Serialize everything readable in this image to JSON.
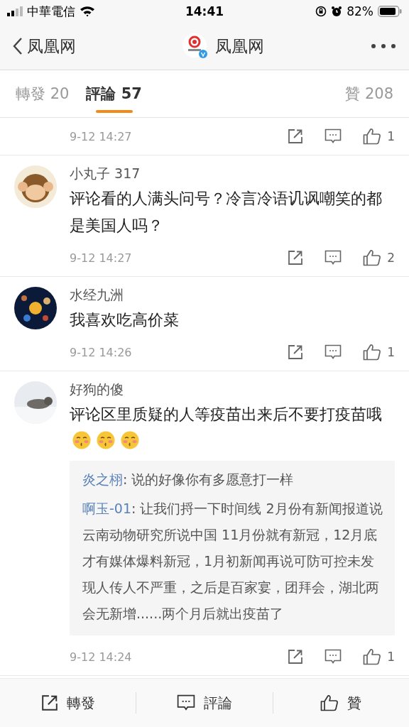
{
  "status_bar": {
    "carrier": "中華電信",
    "time": "14:41",
    "battery": "82%"
  },
  "nav": {
    "back_label": "凤凰网",
    "title": "凤凰网"
  },
  "tabs": [
    {
      "label": "轉發 20",
      "selected": false
    },
    {
      "label": "評論 57",
      "selected": true
    },
    {
      "label": "贊 208",
      "selected": false
    }
  ],
  "comments": [
    {
      "time": "9-12 14:27",
      "likes": "1"
    },
    {
      "avatar": {
        "kind": "picture"
      },
      "name": "小丸子 317",
      "text": "评论看的人满头问号？冷言冷语讥讽嘲笑的都是美国人吗？",
      "time": "9-12 14:27",
      "likes": "2"
    },
    {
      "avatar": {
        "kind": "picture"
      },
      "name": "水经九洲",
      "text": "我喜欢吃高价菜",
      "time": "9-12 14:26",
      "likes": "1"
    },
    {
      "avatar": {
        "kind": "picture"
      },
      "name": "好狗的傻",
      "text": "评论区里质疑的人等疫苗出来后不要打疫苗哦",
      "emojis": [
        {
          "kind": "blush-face"
        },
        {
          "kind": "blush-face"
        },
        {
          "kind": "blush-face"
        }
      ],
      "replies": [
        {
          "name": "炎之栩",
          "text": ": 说的好像你有多愿意打一样"
        },
        {
          "name": "啊玉-01",
          "text": ": 让我们捋一下时间线 2月份有新闻报道说云南动物研究所说中国 11月份就有新冠，12月底才有媒体爆料新冠，1月初新闻再说可防可控未发现人传人不严重，之后是百家宴，团拜会，湖北两会无新增......两个月后就出疫苗了"
        }
      ],
      "time": "9-12 14:24",
      "likes": "1"
    }
  ],
  "bottom_bar": [
    {
      "kind": "repost",
      "label": "轉發"
    },
    {
      "kind": "comment",
      "label": "評論"
    },
    {
      "kind": "like",
      "label": "贊"
    }
  ]
}
